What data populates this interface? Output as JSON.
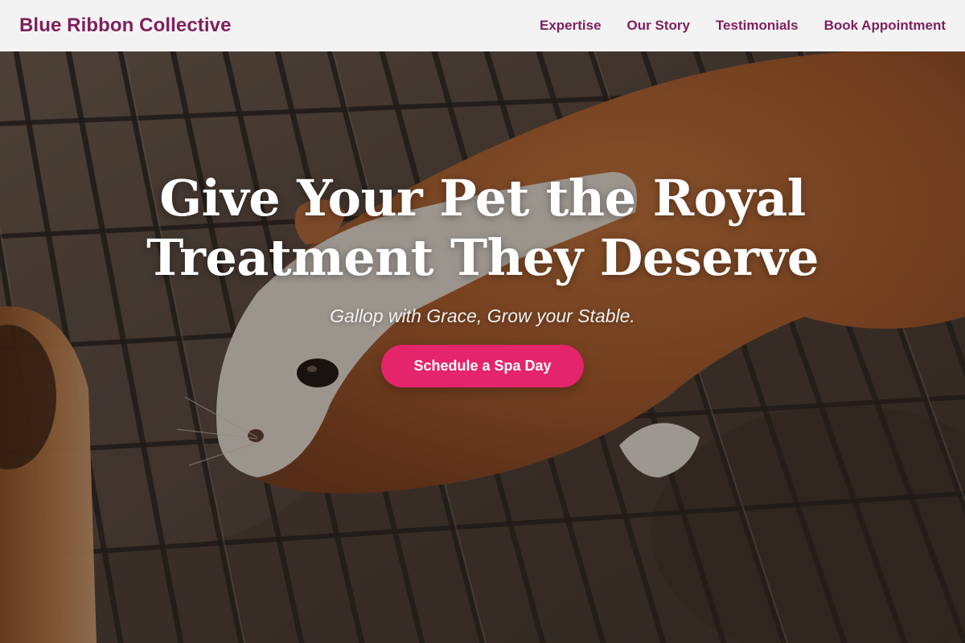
{
  "header": {
    "brand": "Blue Ribbon Collective",
    "nav": [
      {
        "label": "Expertise"
      },
      {
        "label": "Our Story"
      },
      {
        "label": "Testimonials"
      },
      {
        "label": "Book Appointment"
      }
    ]
  },
  "hero": {
    "title_line1": "Give Your Pet the Royal",
    "title_line2": "Treatment They Deserve",
    "tagline": "Gallop with Grace, Grow your Stable.",
    "cta_label": "Schedule a Spa Day",
    "background_image": "guinea pig on a metal wire grate"
  },
  "colors": {
    "brand": "#7e1f5e",
    "nav_text": "#7e1f5e",
    "header_bg": "#f4f3f3",
    "cta_bg": "#e5256b",
    "title_text": "#ffffff"
  }
}
